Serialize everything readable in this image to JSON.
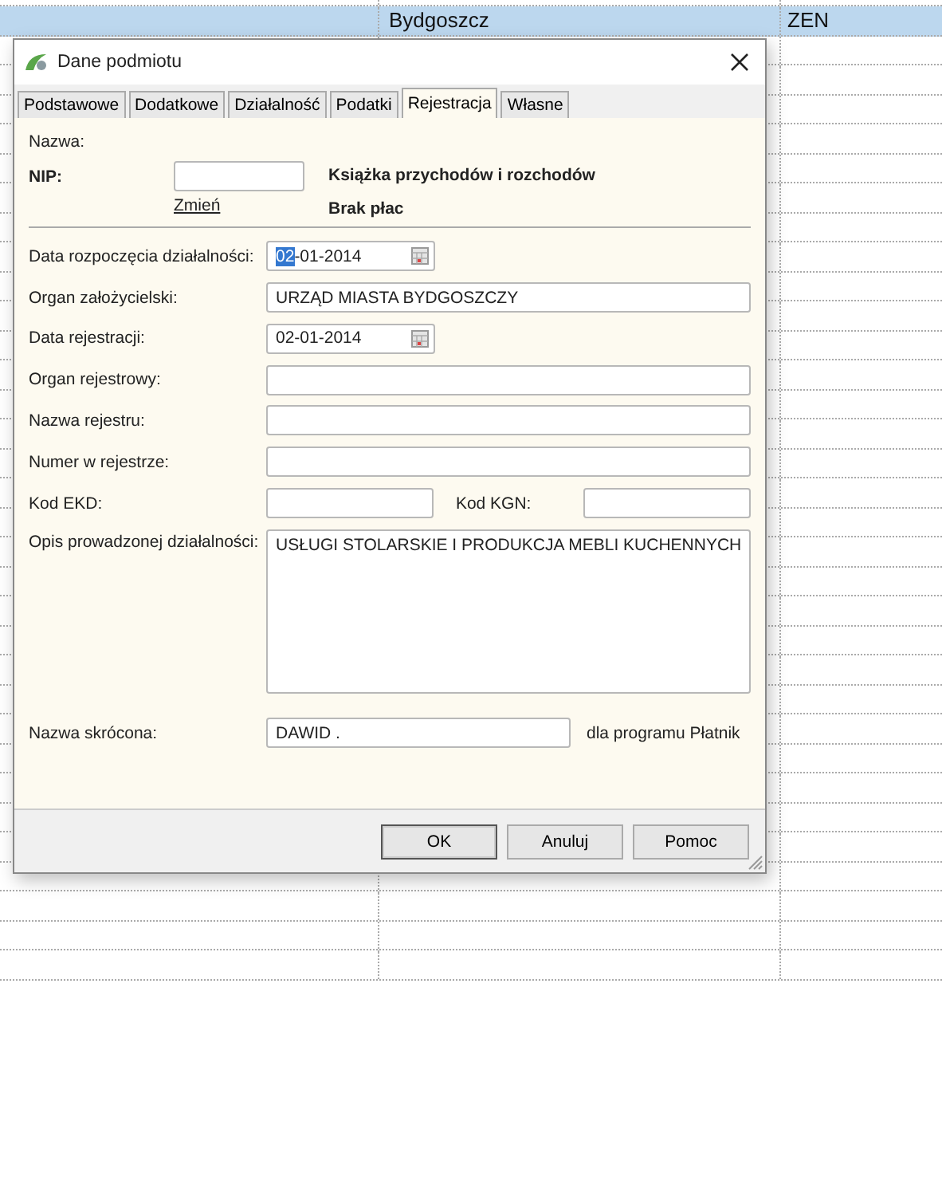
{
  "background_table": {
    "rows": [
      {
        "column_2": "Bydgoszcz",
        "column_3": "ZEN",
        "selected": true
      }
    ]
  },
  "dialog": {
    "title": "Dane podmiotu",
    "tabs": [
      {
        "label": "Podstawowe",
        "selected": false
      },
      {
        "label": "Dodatkowe",
        "selected": false
      },
      {
        "label": "Działalność",
        "selected": false
      },
      {
        "label": "Podatki",
        "selected": false
      },
      {
        "label": "Rejestracja",
        "selected": true
      },
      {
        "label": "Własne",
        "selected": false
      }
    ],
    "header": {
      "name_label": "Nazwa:",
      "nip_label": "NIP:",
      "change_link": "Zmień",
      "info": [
        "Książka przychodów i rozchodów",
        "Brak płac"
      ]
    },
    "fields": [
      {
        "kind": "date",
        "label": "Data rozpoczęcia działalności:",
        "value": "02-01-2014",
        "focused": true
      },
      {
        "kind": "text",
        "label": "Organ założycielski:",
        "value": "URZĄD MIASTA BYDGOSZCZY"
      },
      {
        "kind": "date",
        "label": "Data rejestracji:",
        "value": "02-01-2014",
        "focused": false
      },
      {
        "kind": "text",
        "label": "Organ rejestrowy:"
      },
      {
        "kind": "text",
        "label": "Nazwa rejestru:"
      },
      {
        "kind": "text",
        "label": "Numer w rejestrze:"
      },
      {
        "kind": "pair",
        "label": "Kod EKD:",
        "label_2": "Kod KGN:"
      },
      {
        "kind": "textarea",
        "label": "Opis prowadzonej działalności:",
        "value": "USŁUGI STOLARSKIE I PRODUKCJA MEBLI KUCHENNYCH"
      },
      {
        "kind": "note",
        "label": "Nazwa skrócona:",
        "value": "DAWID .",
        "note": "dla programu Płatnik"
      }
    ],
    "buttons": [
      "OK",
      "Anuluj",
      "Pomoc"
    ]
  }
}
